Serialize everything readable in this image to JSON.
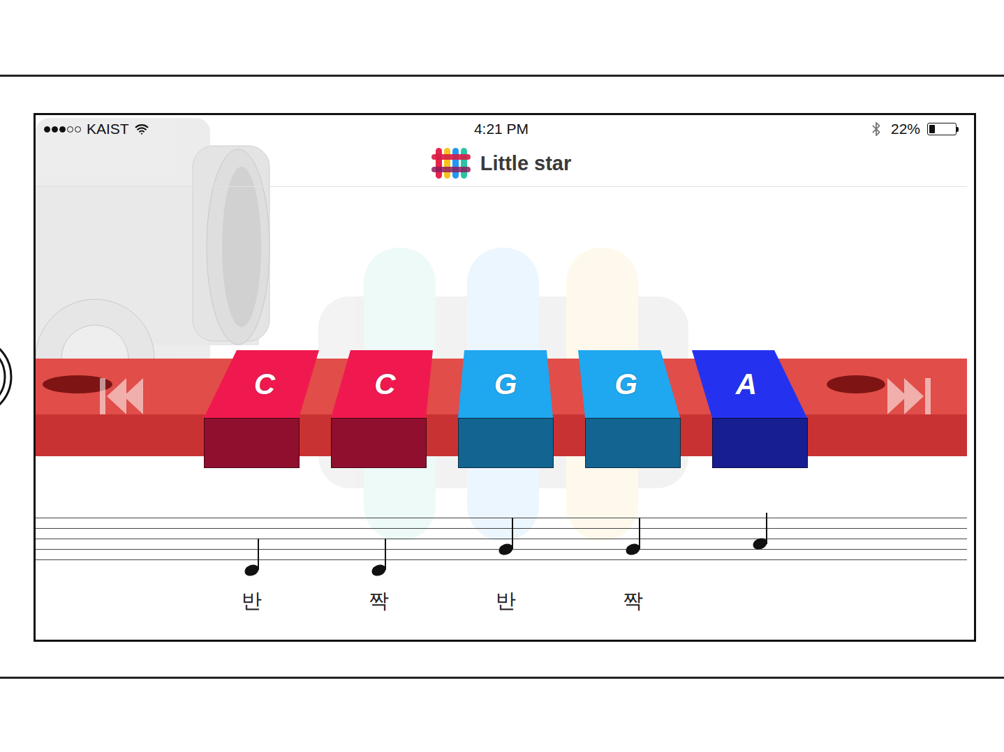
{
  "status_bar": {
    "signal": {
      "filled": 3,
      "total": 5
    },
    "carrier": "KAIST",
    "time": "4:21 PM",
    "battery": "22%",
    "battery_level": 0.22
  },
  "title": "Little star",
  "blocks": [
    {
      "label": "C",
      "color": "#f0194f"
    },
    {
      "label": "C",
      "color": "#f0194f"
    },
    {
      "label": "G",
      "color": "#1fa7f0"
    },
    {
      "label": "G",
      "color": "#1fa7f0"
    },
    {
      "label": "A",
      "color": "#2432f0"
    }
  ],
  "staff": {
    "notes": [
      {
        "pitch": "C4",
        "lyric": "반"
      },
      {
        "pitch": "C4",
        "lyric": "짝"
      },
      {
        "pitch": "G4",
        "lyric": "반"
      },
      {
        "pitch": "G4",
        "lyric": "짝"
      },
      {
        "pitch": "A4"
      }
    ]
  }
}
